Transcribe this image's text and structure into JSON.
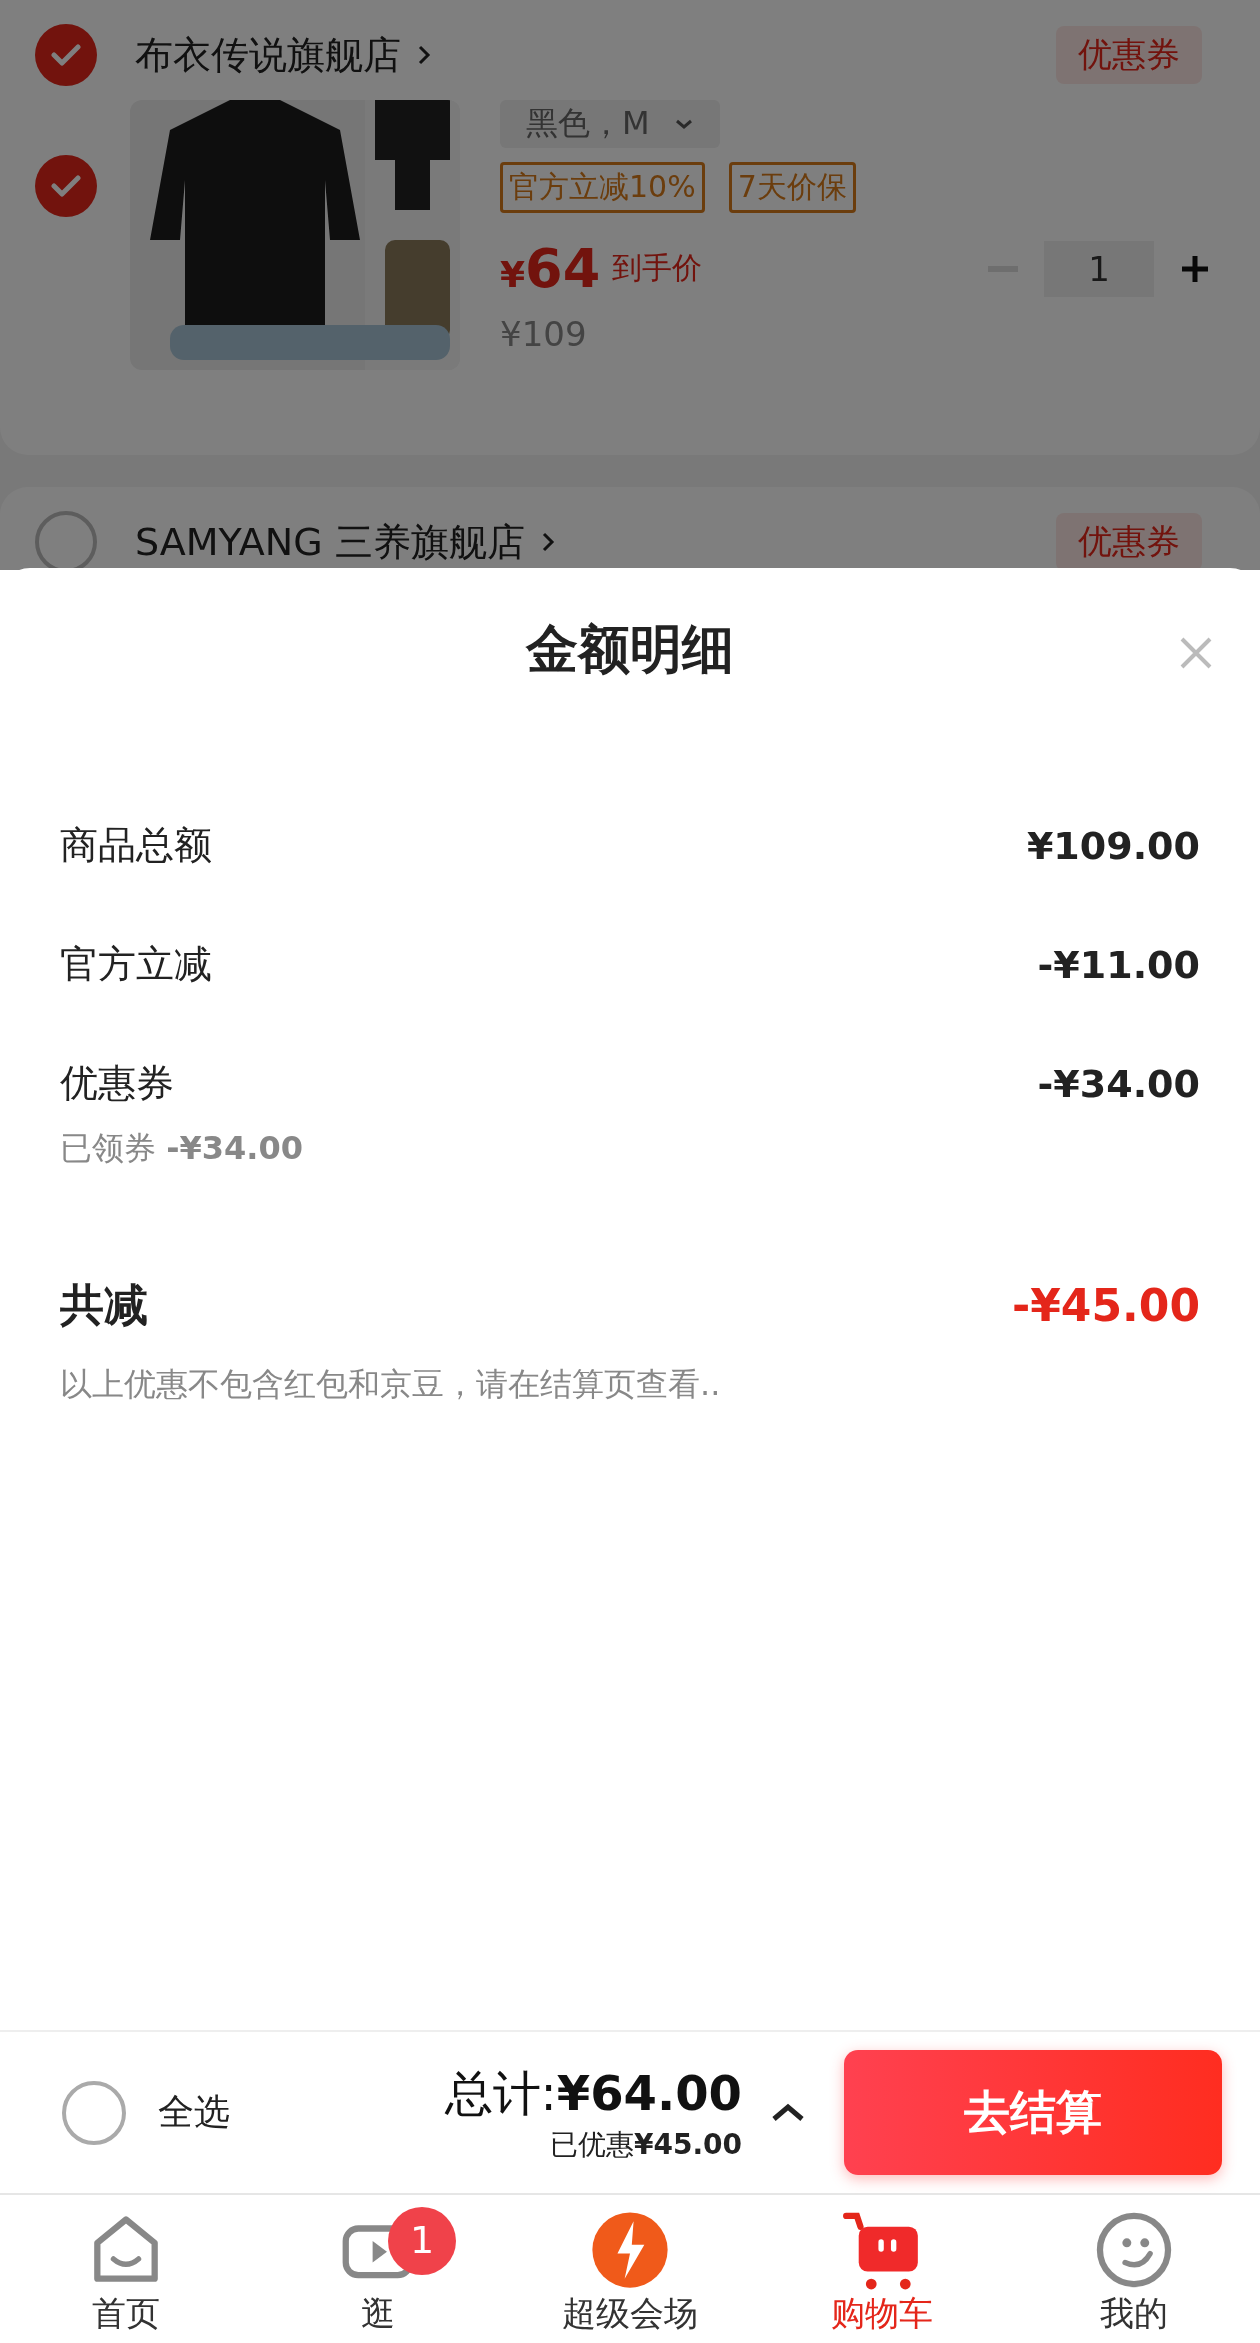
{
  "cart": {
    "stores": [
      {
        "name": "布衣传说旗舰店",
        "checked": true,
        "coupon": "优惠券",
        "items": [
          {
            "checked": true,
            "variant": "黑色，M",
            "tags": [
              "官方立减10%",
              "7天价保"
            ],
            "price_symbol": "¥",
            "price": "64",
            "price_note": "到手价",
            "original_price": "¥109",
            "quantity": "1"
          }
        ]
      },
      {
        "name": "SAMYANG 三养旗舰店",
        "checked": false,
        "coupon": "优惠券"
      }
    ]
  },
  "sheet": {
    "title": "金额明细",
    "rows": [
      {
        "label": "商品总额",
        "value": "¥109.00"
      },
      {
        "label": "官方立减",
        "value": "-¥11.00"
      },
      {
        "label": "优惠券",
        "value": "-¥34.00",
        "note": "已领券 **-¥34.00**"
      }
    ],
    "total": {
      "label": "共减",
      "value": "-¥45.00"
    },
    "note": "以上优惠不包含红包和京豆，请在结算页查看.."
  },
  "checkout_bar": {
    "select_all": {
      "label": "全选",
      "checked": false
    },
    "total": "总计:**¥64.00**",
    "saved": "已优惠**¥45.00**",
    "button": "去结算"
  },
  "tab_bar": [
    {
      "label": "首页",
      "selected": false
    },
    {
      "label": "逛",
      "selected": false,
      "badge": "1"
    },
    {
      "label": "超级会场",
      "selected": false
    },
    {
      "label": "购物车",
      "selected": true
    },
    {
      "label": "我的",
      "selected": false
    }
  ]
}
